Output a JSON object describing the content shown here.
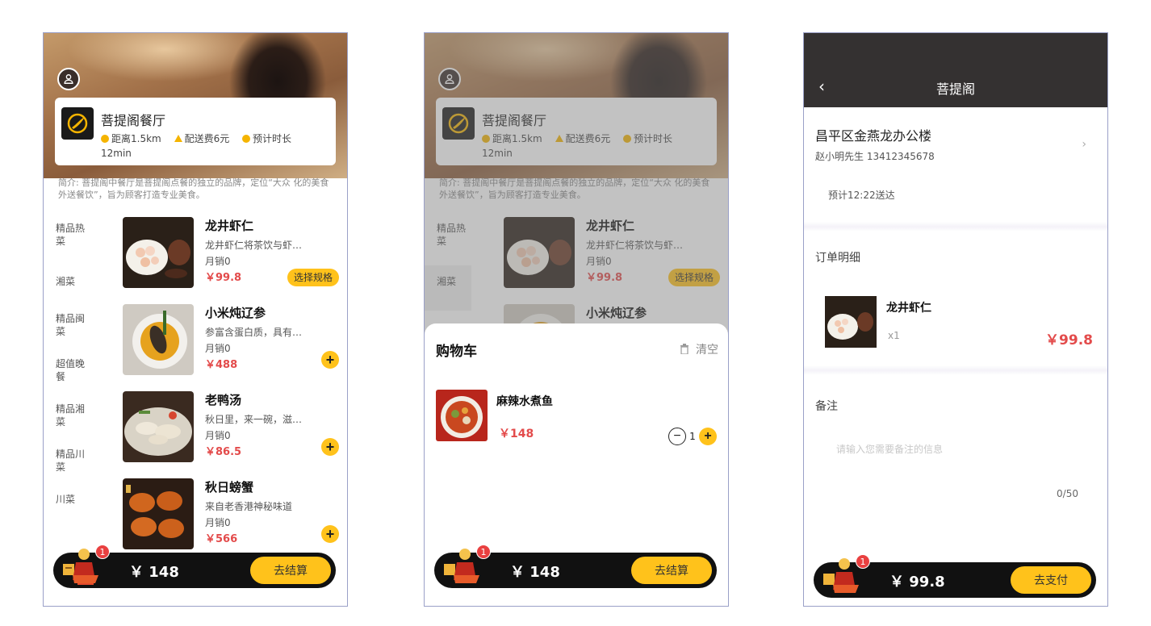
{
  "restaurant": {
    "name": "菩提阁餐厅",
    "distance": "距离1.5km",
    "delivery_fee": "配送费6元",
    "eta": "预计时长",
    "eta_value": "12min",
    "intro": "简介: 菩提阁中餐厅是菩提阁点餐的独立的品牌，定位“大众 化的美食外送餐饮”，旨为顾客打造专业美食。"
  },
  "categories": [
    "精品热菜",
    "湘菜",
    "精品闽菜",
    "超值晚餐",
    "精品湘菜",
    "精品川菜",
    "川菜"
  ],
  "dishes": [
    {
      "name": "龙井虾仁",
      "desc": "龙井虾仁将茶饮与虾…",
      "sales": "月销0",
      "price": "￥99.8",
      "action": "选择规格"
    },
    {
      "name": "小米炖辽参",
      "desc": "参富含蛋白质，具有…",
      "sales": "月销0",
      "price": "￥488"
    },
    {
      "name": "老鸭汤",
      "desc": "秋日里，来一碗，滋…",
      "sales": "月销0",
      "price": "￥86.5"
    },
    {
      "name": "秋日螃蟹",
      "desc": "来自老香港神秘味道",
      "sales": "月销0",
      "price": "￥566"
    }
  ],
  "cart": {
    "badge": "1",
    "total": "￥ 148",
    "checkout": "去结算",
    "sheet_title": "购物车",
    "clear": "清空",
    "item": {
      "name": "麻辣水煮鱼",
      "price": "￥148",
      "qty": "1"
    }
  },
  "order": {
    "title": "菩提阁",
    "back": "‹",
    "address": "昌平区金燕龙办公楼",
    "contact": "赵小明先生 13412345678",
    "eta": "预计12:22送达",
    "details_label": "订单明细",
    "item": {
      "name": "龙井虾仁",
      "qty": "x1",
      "price": "￥99.8"
    },
    "remark_label": "备注",
    "remark_placeholder": "请输入您需要备注的信息",
    "remark_counter": "0/50",
    "total": "￥ 99.8",
    "pay": "去支付",
    "badge": "1"
  },
  "icons": {
    "user": "user-icon",
    "logo": "restaurant-logo-icon",
    "clock": "clock-icon",
    "delivery": "delivery-icon",
    "time": "timer-icon",
    "cart": "cart-mascot-icon",
    "trash": "trash-icon",
    "chevron": "chevron-right-icon"
  },
  "colors": {
    "accent": "#ffc21b",
    "price": "#e34b4b",
    "bar": "#111111",
    "header": "#343131"
  }
}
